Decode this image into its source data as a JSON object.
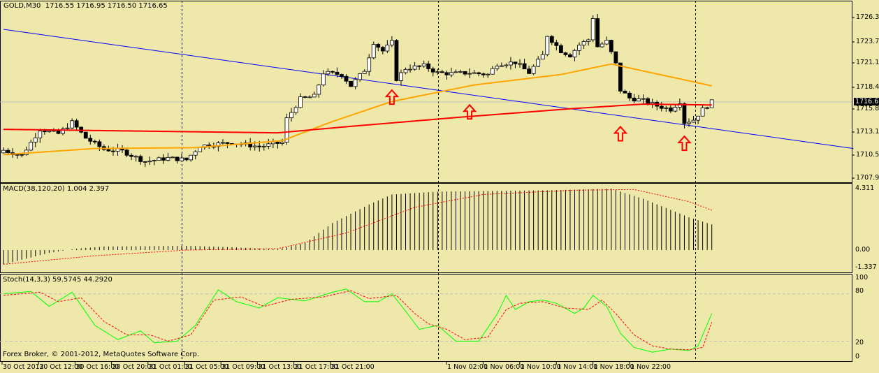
{
  "header": {
    "symbol": "GOLD,M30",
    "ohlc": "1716.55 1716.95 1716.50 1716.65"
  },
  "macd": {
    "label": "MACD(38,120,20) 1.004 2.397",
    "axis": [
      "4.311",
      "0.00",
      "-1.337"
    ]
  },
  "stoch": {
    "label": "Stoch(14,3,3) 59.5745 44.2920",
    "axis": [
      "100",
      "80",
      "20",
      "0"
    ]
  },
  "copyright": "Forex Broker, © 2001-2012, MetaQuotes Software Corp.",
  "price_axis": [
    "1726.35",
    "1723.75",
    "1721.10",
    "1718.45",
    "1715.80",
    "1713.15",
    "1710.55",
    "1707.90"
  ],
  "current_price": "1716.65",
  "time_axis": [
    "30 Oct 2012",
    "30 Oct 12:00",
    "30 Oct 16:00",
    "30 Oct 20:00",
    "31 Oct 01:00",
    "31 Oct 05:00",
    "31 Oct 09:00",
    "31 Oct 13:00",
    "31 Oct 17:00",
    "31 Oct 21:00",
    "1 Nov 02:00",
    "1 Nov 06:00",
    "1 Nov 10:00",
    "1 Nov 14:00",
    "1 Nov 18:00",
    "1 Nov 22:00"
  ],
  "colors": {
    "bg": "#eee8aa",
    "ma_slow": "#ff0000",
    "ma_fast": "#ffa500",
    "trendline": "#0000ff",
    "stoch_main": "#00ff00",
    "stoch_signal": "#ff0000",
    "arrow": "#ff0000"
  },
  "chart_data": {
    "type": "candlestick",
    "bars": 156,
    "price_range": [
      1707.9,
      1726.35
    ],
    "close_anchors": [
      [
        0,
        1711.1
      ],
      [
        4,
        1710.5
      ],
      [
        8,
        1713.5
      ],
      [
        12,
        1713.0
      ],
      [
        15,
        1714.3
      ],
      [
        18,
        1712.5
      ],
      [
        22,
        1711.2
      ],
      [
        26,
        1711.0
      ],
      [
        31,
        1709.8
      ],
      [
        36,
        1710.2
      ],
      [
        40,
        1710.0
      ],
      [
        43,
        1711.6
      ],
      [
        50,
        1712.0
      ],
      [
        56,
        1711.5
      ],
      [
        61,
        1712.0
      ],
      [
        62,
        1714.7
      ],
      [
        65,
        1717.0
      ],
      [
        68,
        1717.3
      ],
      [
        70,
        1720.0
      ],
      [
        74,
        1719.8
      ],
      [
        76,
        1718.5
      ],
      [
        79,
        1720.3
      ],
      [
        81,
        1723.5
      ],
      [
        83,
        1722.5
      ],
      [
        85,
        1723.5
      ],
      [
        86,
        1719.3
      ],
      [
        88,
        1720.5
      ],
      [
        92,
        1720.8
      ],
      [
        95,
        1720.0
      ],
      [
        98,
        1719.9
      ],
      [
        102,
        1720.0
      ],
      [
        106,
        1719.8
      ],
      [
        108,
        1721.0
      ],
      [
        112,
        1721.2
      ],
      [
        115,
        1720.0
      ],
      [
        118,
        1722.0
      ],
      [
        119,
        1724.3
      ],
      [
        122,
        1722.5
      ],
      [
        124,
        1722.0
      ],
      [
        126,
        1723.2
      ],
      [
        128,
        1723.8
      ],
      [
        129,
        1726.35
      ],
      [
        130,
        1723.0
      ],
      [
        132,
        1723.6
      ],
      [
        134,
        1721.0
      ],
      [
        135,
        1718.0
      ],
      [
        137,
        1717.1
      ],
      [
        140,
        1716.8
      ],
      [
        143,
        1716.2
      ],
      [
        146,
        1715.8
      ],
      [
        148,
        1716.7
      ],
      [
        149,
        1714.3
      ],
      [
        151,
        1714.6
      ],
      [
        153,
        1715.8
      ],
      [
        155,
        1716.65
      ]
    ],
    "ma_fast_anchors": [
      [
        0,
        1710.6
      ],
      [
        20,
        1711.3
      ],
      [
        42,
        1711.4
      ],
      [
        61,
        1712.2
      ],
      [
        72,
        1714.4
      ],
      [
        85,
        1716.7
      ],
      [
        103,
        1718.6
      ],
      [
        122,
        1719.8
      ],
      [
        133,
        1721.0
      ],
      [
        155,
        1718.5
      ]
    ],
    "ma_slow_anchors": [
      [
        0,
        1713.5
      ],
      [
        60,
        1713.1
      ],
      [
        75,
        1713.8
      ],
      [
        100,
        1714.9
      ],
      [
        125,
        1715.9
      ],
      [
        140,
        1716.4
      ],
      [
        155,
        1716.3
      ]
    ],
    "trendline": [
      [
        0,
        1724.99
      ],
      [
        186,
        1711.3
      ]
    ],
    "arrows_at_bars": [
      [
        85,
        1718.0
      ],
      [
        102,
        1716.3
      ],
      [
        135,
        1713.8
      ],
      [
        149,
        1712.7
      ]
    ],
    "macd_hist_anchors": [
      [
        0,
        -1.0
      ],
      [
        10,
        -0.2
      ],
      [
        16,
        0.1
      ],
      [
        22,
        0.25
      ],
      [
        40,
        0.3
      ],
      [
        50,
        0.2
      ],
      [
        60,
        0.05
      ],
      [
        66,
        0.5
      ],
      [
        72,
        1.9
      ],
      [
        80,
        3.2
      ],
      [
        85,
        3.9
      ],
      [
        95,
        4.1
      ],
      [
        120,
        4.2
      ],
      [
        133,
        4.31
      ],
      [
        140,
        3.6
      ],
      [
        150,
        2.3
      ],
      [
        155,
        1.8
      ]
    ],
    "macd_signal_anchors": [
      [
        0,
        -1.0
      ],
      [
        20,
        -0.4
      ],
      [
        40,
        0.0
      ],
      [
        60,
        0.1
      ],
      [
        75,
        1.2
      ],
      [
        90,
        3.0
      ],
      [
        105,
        3.9
      ],
      [
        125,
        4.2
      ],
      [
        138,
        4.25
      ],
      [
        150,
        3.4
      ],
      [
        155,
        2.8
      ]
    ],
    "stoch_main_anchors": [
      [
        0,
        80
      ],
      [
        6,
        83
      ],
      [
        10,
        64
      ],
      [
        15,
        82
      ],
      [
        20,
        40
      ],
      [
        25,
        22
      ],
      [
        30,
        33
      ],
      [
        33,
        18
      ],
      [
        38,
        20
      ],
      [
        42,
        40
      ],
      [
        47,
        85
      ],
      [
        51,
        70
      ],
      [
        56,
        62
      ],
      [
        60,
        75
      ],
      [
        66,
        71
      ],
      [
        72,
        82
      ],
      [
        75,
        86
      ],
      [
        79,
        70
      ],
      [
        82,
        70
      ],
      [
        85,
        80
      ],
      [
        88,
        58
      ],
      [
        91,
        35
      ],
      [
        95,
        40
      ],
      [
        99,
        20
      ],
      [
        104,
        20
      ],
      [
        108,
        54
      ],
      [
        110,
        78
      ],
      [
        112,
        60
      ],
      [
        115,
        70
      ],
      [
        118,
        72
      ],
      [
        121,
        68
      ],
      [
        125,
        55
      ],
      [
        127,
        62
      ],
      [
        129,
        78
      ],
      [
        132,
        64
      ],
      [
        135,
        30
      ],
      [
        138,
        12
      ],
      [
        142,
        6
      ],
      [
        146,
        10
      ],
      [
        150,
        8
      ],
      [
        152,
        14
      ],
      [
        155,
        55
      ]
    ],
    "stoch_signal_anchors": [
      [
        0,
        78
      ],
      [
        8,
        82
      ],
      [
        12,
        70
      ],
      [
        17,
        75
      ],
      [
        22,
        45
      ],
      [
        27,
        28
      ],
      [
        32,
        28
      ],
      [
        36,
        20
      ],
      [
        41,
        28
      ],
      [
        46,
        72
      ],
      [
        52,
        76
      ],
      [
        57,
        64
      ],
      [
        63,
        73
      ],
      [
        70,
        76
      ],
      [
        76,
        84
      ],
      [
        80,
        74
      ],
      [
        86,
        78
      ],
      [
        90,
        55
      ],
      [
        93,
        42
      ],
      [
        97,
        35
      ],
      [
        101,
        22
      ],
      [
        106,
        25
      ],
      [
        110,
        60
      ],
      [
        113,
        68
      ],
      [
        118,
        70
      ],
      [
        123,
        62
      ],
      [
        128,
        60
      ],
      [
        131,
        72
      ],
      [
        134,
        55
      ],
      [
        138,
        28
      ],
      [
        142,
        14
      ],
      [
        146,
        10
      ],
      [
        150,
        9
      ],
      [
        153,
        12
      ],
      [
        155,
        44
      ]
    ],
    "stoch_levels": [
      20,
      80
    ]
  }
}
